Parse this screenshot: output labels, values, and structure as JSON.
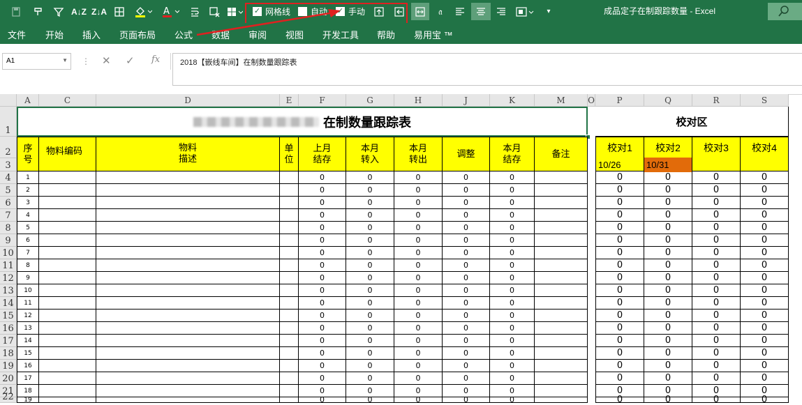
{
  "window": {
    "title": "成品定子在制跟踪数量 - Excel"
  },
  "qat": {
    "gridlines_label": "网格线",
    "gridlines_checked": true,
    "auto_label": "自动",
    "auto_checked": false,
    "manual_label": "手动",
    "manual_checked": true
  },
  "tabs": [
    "文件",
    "开始",
    "插入",
    "页面布局",
    "公式",
    "数据",
    "审阅",
    "视图",
    "开发工具",
    "帮助",
    "易用宝 ™"
  ],
  "formula_bar": {
    "name_box": "A1",
    "formula": "2018【嵌线车间】在制数量跟踪表"
  },
  "sheet": {
    "columns": [
      "A",
      "C",
      "D",
      "E",
      "F",
      "G",
      "H",
      "J",
      "K",
      "M",
      "O",
      "P",
      "Q",
      "R",
      "S"
    ],
    "rows": [
      "1",
      "2",
      "3",
      "4",
      "5",
      "6",
      "7",
      "8",
      "9",
      "10",
      "11",
      "12",
      "13",
      "14",
      "15",
      "16",
      "17",
      "18",
      "19",
      "20",
      "21",
      "22"
    ],
    "title": "在制数量跟踪表",
    "check_title": "校对区",
    "headers": {
      "seq": "序号",
      "code": "物料编码",
      "desc": "物料描述",
      "unit": "单位",
      "last_stock": "上月结存",
      "in": "本月转入",
      "out": "本月转出",
      "adjust": "调整",
      "stock": "本月结存",
      "remark": "备注"
    },
    "check_headers": [
      "校对1",
      "校对2",
      "校对3",
      "校对4"
    ],
    "check_dates": [
      "10/26",
      "10/31",
      "",
      ""
    ],
    "seq_numbers": [
      "1",
      "2",
      "3",
      "4",
      "5",
      "6",
      "7",
      "8",
      "9",
      "10",
      "11",
      "12",
      "13",
      "14",
      "15",
      "16",
      "17",
      "18",
      "19"
    ],
    "zero_value": "0"
  },
  "colors": {
    "excel_green": "#217346",
    "header_yellow": "#ffff00",
    "highlight_orange": "#e26b0a",
    "annotation_red": "#e02020"
  }
}
